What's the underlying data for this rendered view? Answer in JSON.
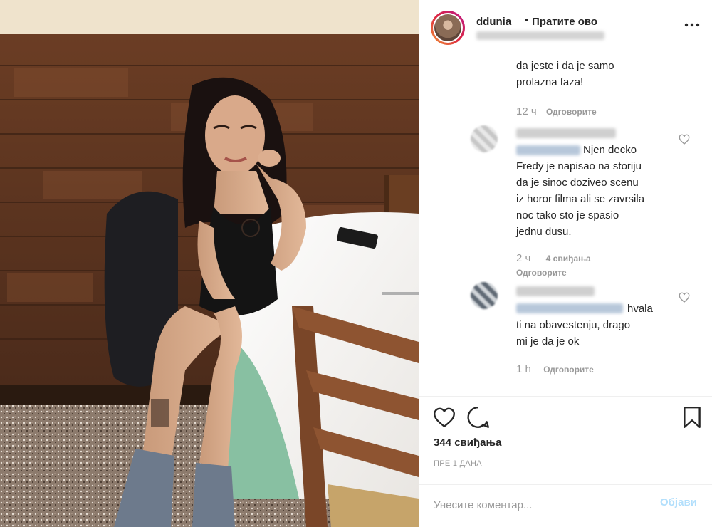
{
  "post": {
    "username": "ddunia",
    "dot": "•",
    "follow_label": "Пратите ово",
    "more_icon": "more-dots-icon"
  },
  "comments": [
    {
      "text": "da jeste i da je samo\nprolazna faza!",
      "time": "12 ч",
      "reply_label": "Одговорите"
    },
    {
      "text": "Njen decko\nFredy je napisao na storiju\nda je sinoc doziveo scenu\niz horor filma ali se zavrsila\nnoc tako sto je spasio\njednu dusu.",
      "time": "2 ч",
      "likes": "4 свиђања",
      "reply_label": "Одговорите"
    },
    {
      "text": "hvala\nti na obavestenju, drago\nmi je da je ok",
      "time": "1 h",
      "reply_label": "Одговорите"
    }
  ],
  "actions": {
    "likes_count": "344 свиђања",
    "posted_time": "ПРЕ 1 ДАНА"
  },
  "comment_box": {
    "placeholder": "Унесите коментар...",
    "post_label": "Објави"
  },
  "colors": {
    "text": "#262626",
    "muted": "#999999",
    "post_button": "#b2dffc",
    "avatar_ring": "#dc2743"
  }
}
